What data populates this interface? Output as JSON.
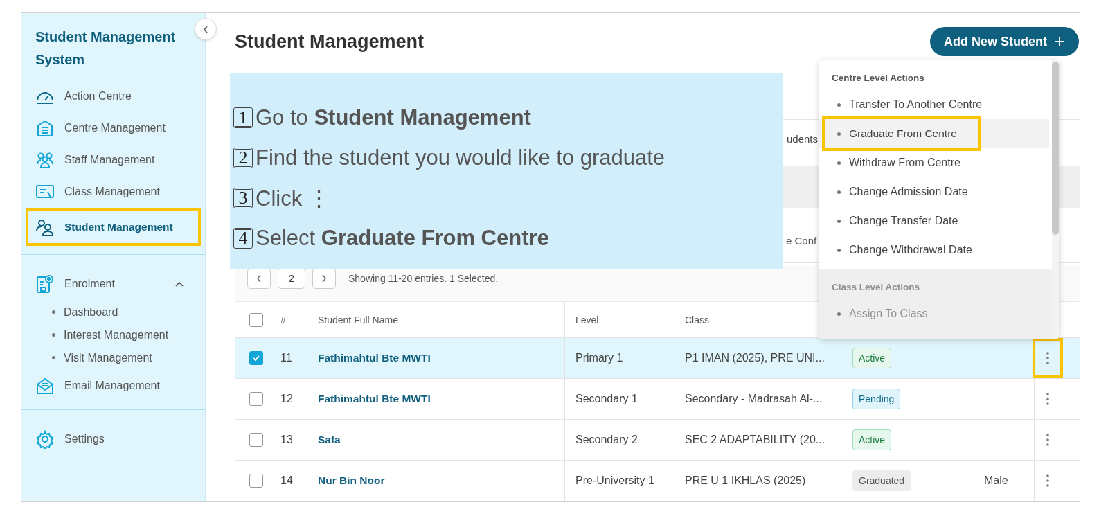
{
  "sidebar": {
    "title": "Student Management System",
    "collapse_button": "‹",
    "sections": [
      {
        "items": [
          {
            "label": "Action Centre",
            "selected": false,
            "highlighted": false
          },
          {
            "label": "Centre Management",
            "selected": false,
            "highlighted": false
          },
          {
            "label": "Staff Management",
            "selected": false,
            "highlighted": false
          },
          {
            "label": "Class Management",
            "selected": false,
            "highlighted": false
          },
          {
            "label": "Student Management",
            "selected": true,
            "highlighted": true
          }
        ]
      },
      {
        "items": [
          {
            "label": "Enrolment",
            "selected": false,
            "highlighted": false,
            "expanded": true,
            "children": [
              {
                "label": "Dashboard"
              },
              {
                "label": "Interest Management"
              },
              {
                "label": "Visit Management"
              }
            ]
          },
          {
            "label": "Email Management",
            "selected": false,
            "highlighted": false
          }
        ]
      },
      {
        "items": [
          {
            "label": "Settings",
            "selected": false,
            "highlighted": false
          }
        ]
      }
    ]
  },
  "page": {
    "title": "Student Management",
    "add_button": "Add New Student"
  },
  "background_controls": [
    {
      "kind": "button",
      "text": "udents"
    },
    {
      "kind": "field",
      "text": "e Conf"
    }
  ],
  "instructions": [
    {
      "number": "1",
      "text": "Go to **Student Management**"
    },
    {
      "number": "2",
      "text": "Find the student you would like to graduate"
    },
    {
      "number": "3",
      "text": "Click ⋮"
    },
    {
      "number": "4",
      "text": "Select **Graduate From Centre**"
    }
  ],
  "pagination": {
    "page": "2",
    "summary": "Showing 11-20 entries. 1 Selected."
  },
  "table": {
    "select_all_checked": false,
    "columns": [
      "#",
      "Student Full Name",
      "Level",
      "Class"
    ],
    "rows": [
      {
        "number": "11",
        "name": "Fathimahtul Bte MWTI",
        "level": "Primary 1",
        "class": "P1 IMAN (2025), PRE UNI...",
        "status": {
          "label": "Active",
          "kind": "active"
        },
        "gender": null,
        "selected": true,
        "actions_highlighted": true
      },
      {
        "number": "12",
        "name": "Fathimahtul Bte MWTI",
        "level": "Secondary 1",
        "class": "Secondary - Madrasah Al-...",
        "status": {
          "label": "Pending",
          "kind": "pending"
        },
        "gender": null,
        "selected": false,
        "actions_highlighted": false
      },
      {
        "number": "13",
        "name": "Safa",
        "level": "Secondary 2",
        "class": "SEC 2 ADAPTABILITY (20...",
        "status": {
          "label": "Active",
          "kind": "active"
        },
        "gender": null,
        "selected": false,
        "actions_highlighted": false
      },
      {
        "number": "14",
        "name": "Nur Bin Noor",
        "level": "Pre-University 1",
        "class": "PRE U 1 IKHLAS (2025)",
        "status": {
          "label": "Graduated",
          "kind": "graduated"
        },
        "gender": "Male",
        "selected": false,
        "actions_highlighted": false
      }
    ]
  },
  "action_menu": {
    "sections": [
      {
        "title": "Centre Level Actions",
        "disabled": false,
        "items": [
          {
            "label": "Transfer To Another Centre",
            "selected": false,
            "highlighted": false
          },
          {
            "label": "Graduate From Centre",
            "selected": true,
            "highlighted": true
          },
          {
            "label": "Withdraw From Centre",
            "selected": false,
            "highlighted": false
          },
          {
            "label": "Change Admission Date",
            "selected": false,
            "highlighted": false
          },
          {
            "label": "Change Transfer Date",
            "selected": false,
            "highlighted": false
          },
          {
            "label": "Change Withdrawal Date",
            "selected": false,
            "highlighted": false
          }
        ]
      },
      {
        "title": "Class Level Actions",
        "disabled": true,
        "items": [
          {
            "label": "Assign To Class",
            "selected": false,
            "highlighted": false
          }
        ]
      }
    ]
  }
}
